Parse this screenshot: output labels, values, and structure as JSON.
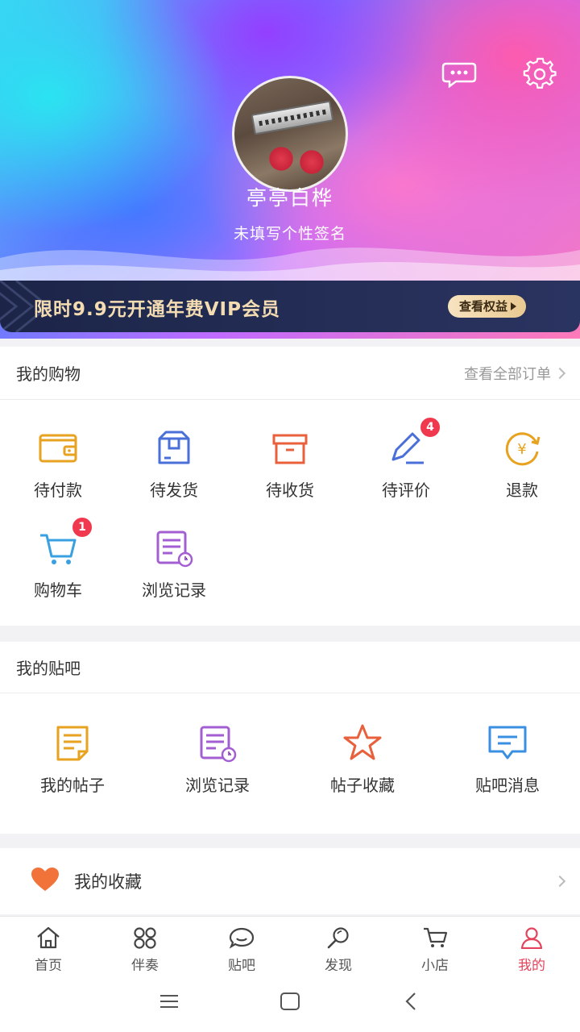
{
  "profile": {
    "username": "亭亭白桦",
    "signature": "未填写个性签名",
    "message_icon": "chat-bubble-icon",
    "settings_icon": "gear-icon"
  },
  "vip": {
    "text": "限时9.9元开通年费VIP会员",
    "button": "查看权益"
  },
  "shopping": {
    "title": "我的购物",
    "view_all": "查看全部订单",
    "items": [
      {
        "label": "待付款",
        "icon": "wallet-icon"
      },
      {
        "label": "待发货",
        "icon": "package-icon"
      },
      {
        "label": "待收货",
        "icon": "box-icon"
      },
      {
        "label": "待评价",
        "icon": "pen-icon",
        "badge": "4"
      },
      {
        "label": "退款",
        "icon": "refund-yen-icon"
      },
      {
        "label": "购物车",
        "icon": "cart-icon",
        "badge": "1"
      },
      {
        "label": "浏览记录",
        "icon": "history-doc-icon"
      }
    ]
  },
  "tieba": {
    "title": "我的贴吧",
    "items": [
      {
        "label": "我的帖子",
        "icon": "note-icon"
      },
      {
        "label": "浏览记录",
        "icon": "history-doc-icon"
      },
      {
        "label": "帖子收藏",
        "icon": "star-icon"
      },
      {
        "label": "贴吧消息",
        "icon": "message-icon"
      }
    ]
  },
  "favorites": {
    "label": "我的收藏",
    "icon": "heart-icon"
  },
  "tabs": [
    {
      "label": "首页",
      "icon": "home-icon"
    },
    {
      "label": "伴奏",
      "icon": "grid-icon"
    },
    {
      "label": "贴吧",
      "icon": "bubble-icon"
    },
    {
      "label": "发现",
      "icon": "search-icon"
    },
    {
      "label": "小店",
      "icon": "cart-icon"
    },
    {
      "label": "我的",
      "icon": "user-icon",
      "active": true
    }
  ],
  "colors": {
    "accent": "#e4435b",
    "badge": "#f0384e",
    "vip_bg": "#1c2548",
    "vip_text": "#f3dcb2"
  }
}
